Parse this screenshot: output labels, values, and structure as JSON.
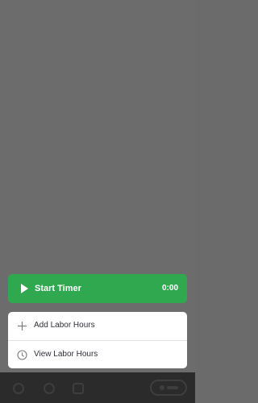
{
  "timer": {
    "label": "Start Timer",
    "value": "0:00",
    "icon": "play-icon",
    "color": "#2fa84f"
  },
  "menu": {
    "items": [
      {
        "label": "Add Labor Hours",
        "icon": "plus-icon"
      },
      {
        "label": "View Labor Hours",
        "icon": "clock-icon"
      }
    ]
  }
}
